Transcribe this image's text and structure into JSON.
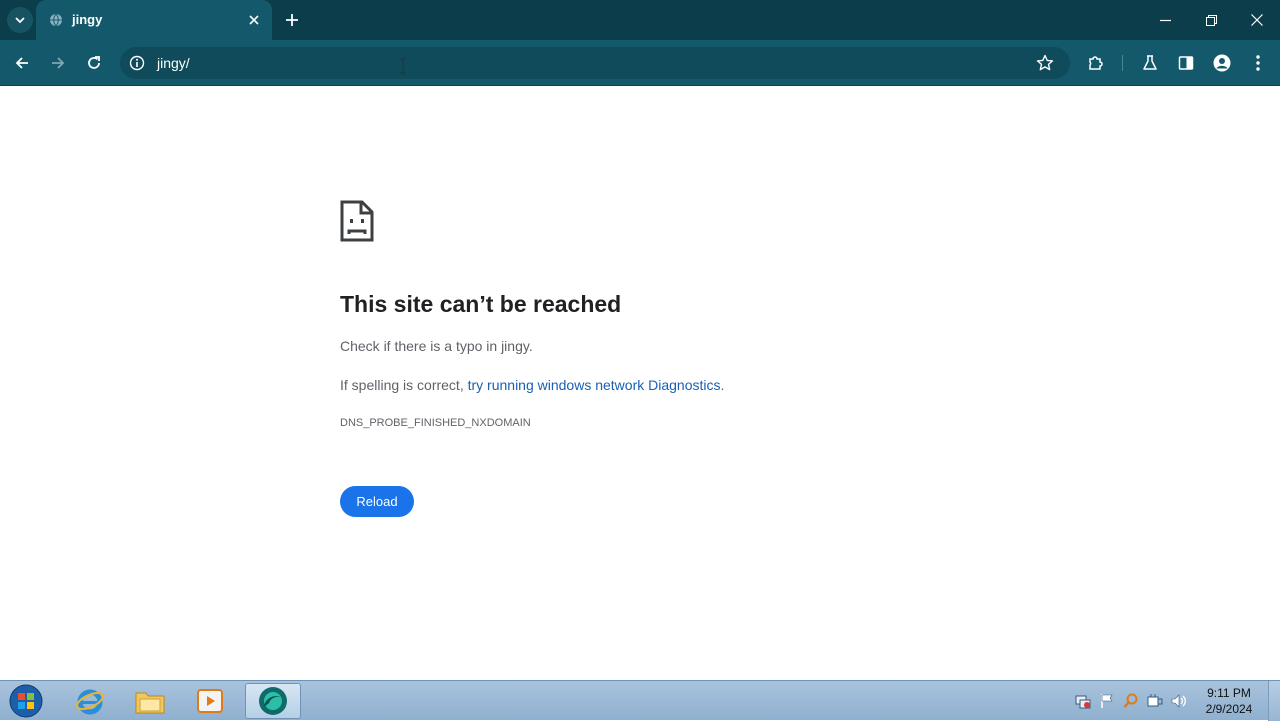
{
  "browser": {
    "tab": {
      "title": "jingy",
      "favicon": "globe-icon"
    },
    "url": "jingy/",
    "icons": {
      "tab_search": "chevron-down-icon",
      "tab_close": "close-icon",
      "new_tab": "plus-icon",
      "minimize": "minimize-icon",
      "restore": "restore-icon",
      "close": "close-icon",
      "back": "arrow-left-icon",
      "forward": "arrow-right-icon",
      "reload": "reload-icon",
      "site_info": "info-icon",
      "bookmark": "star-icon",
      "extensions": "puzzle-icon",
      "labs": "flask-icon",
      "side_panel": "side-panel-icon",
      "profile": "person-icon",
      "menu": "kebab-menu-icon"
    }
  },
  "error_page": {
    "icon": "sad-document-icon",
    "heading": "This site can’t be reached",
    "line1": "Check if there is a typo in jingy.",
    "line2_prefix": "If spelling is correct, ",
    "line2_link": "try running windows network Diagnostics",
    "line2_suffix": ".",
    "error_code": "DNS_PROBE_FINISHED_NXDOMAIN",
    "reload_label": "Reload"
  },
  "taskbar": {
    "pinned": [
      "internet-explorer-icon",
      "file-explorer-icon",
      "media-player-icon",
      "chrome-app-icon"
    ],
    "active_app": "chrome-app-icon",
    "tray": [
      "network-icon",
      "action-center-flag-icon",
      "search-tray-icon",
      "power-icon",
      "volume-icon"
    ],
    "time": "9:11 PM",
    "date": "2/9/2024"
  },
  "colors": {
    "titlebar": "#0b3d4b",
    "toolbar": "#14596b",
    "link": "#1a5fb4",
    "reload_button": "#1a73e8"
  }
}
